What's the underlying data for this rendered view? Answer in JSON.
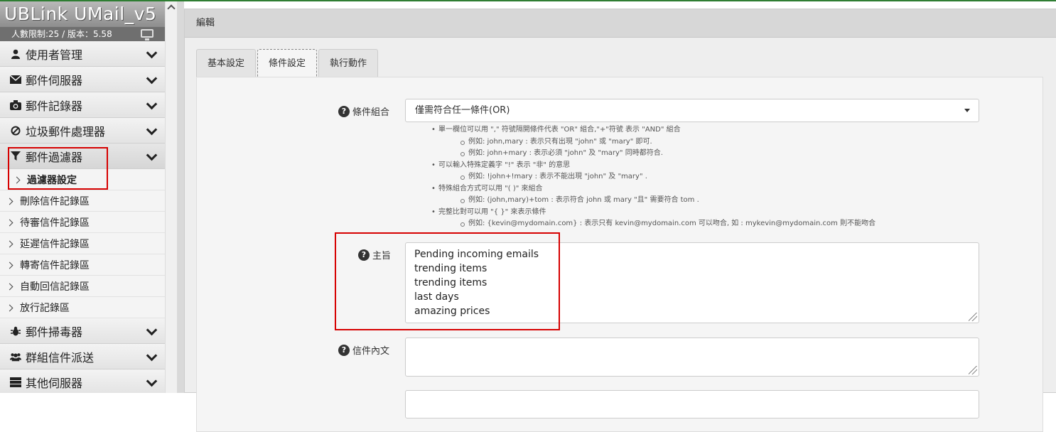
{
  "brand": {
    "title": "UBLink UMail_v5",
    "info": "人數限制:25 / 版本：5.58"
  },
  "sidebar": {
    "menu_top": [
      {
        "label": "使用者管理",
        "icon": "user-icon"
      },
      {
        "label": "郵件伺服器",
        "icon": "envelope-icon"
      },
      {
        "label": "郵件記錄器",
        "icon": "camera-icon"
      },
      {
        "label": "垃圾郵件處理器",
        "icon": "ban-icon"
      },
      {
        "label": "郵件過濾器",
        "icon": "filter-icon"
      }
    ],
    "filter_sub": "過濾器設定",
    "logs": [
      "刪除信件記錄區",
      "待審信件記錄區",
      "延遲信件記錄區",
      "轉寄信件記錄區",
      "自動回信記錄區",
      "放行記錄區"
    ],
    "menu_bottom": [
      {
        "label": "郵件掃毒器",
        "icon": "bug-icon"
      },
      {
        "label": "群組信件派送",
        "icon": "users-icon"
      },
      {
        "label": "其他伺服器",
        "icon": "server-icon"
      }
    ]
  },
  "panel": {
    "title": "編輯"
  },
  "tabs": [
    "基本設定",
    "條件設定",
    "執行動作"
  ],
  "condition": {
    "label": "條件組合",
    "selected": "僅需符合任一條件(OR)",
    "help": [
      {
        "level": 1,
        "text": "單一欄位可以用 \",\" 符號隔開條件代表 \"OR\" 組合,\"+\"符號 表示 \"AND\" 組合"
      },
      {
        "level": 2,
        "text": "例如: john,mary : 表示只有出現 \"john\" 或 \"mary\" 即可."
      },
      {
        "level": 2,
        "text": "例如: john+mary : 表示必須 \"john\" 及 \"mary\" 同時都符合."
      },
      {
        "level": 1,
        "text": "可以輸入特殊定義字 \"!\" 表示 \"非\" 的意思"
      },
      {
        "level": 2,
        "text": "例如: !john+!mary : 表示不能出現 \"john\" 及 \"mary\" ."
      },
      {
        "level": 1,
        "text": "特殊組合方式可以用 \"( )\" 來組合"
      },
      {
        "level": 2,
        "text": "例如: (john,mary)+tom : 表示符合 john 或 mary \"且\" 需要符合 tom ."
      },
      {
        "level": 1,
        "text": "完整比對可以用 \"{ }\" 來表示條件"
      },
      {
        "level": 2,
        "text": "例如: {kevin@mydomain.com} : 表示只有 kevin@mydomain.com 可以吻合, 如 : mykevin@mydomain.com 則不能吻合"
      }
    ]
  },
  "subject": {
    "label": "主旨",
    "lines": [
      "Pending incoming emails",
      "trending items",
      "trending items",
      "last days",
      "amazing prices"
    ]
  },
  "body_field": {
    "label": "信件內文",
    "value": ""
  }
}
